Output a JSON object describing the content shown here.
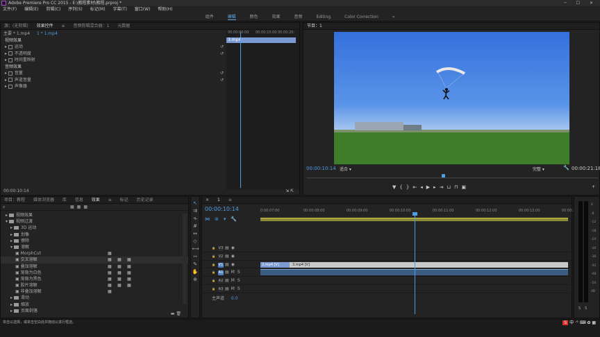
{
  "window": {
    "title": "Adobe Premiere Pro CC 2015 - E:\\教程素材\\教程.prproj *",
    "controls": "─ ☐ ✕"
  },
  "menu": [
    "文件(F)",
    "编辑(E)",
    "剪辑(C)",
    "序列(S)",
    "标记(M)",
    "字幕(T)",
    "窗口(W)",
    "帮助(H)"
  ],
  "workspaces": {
    "items": [
      "组件",
      "编辑",
      "颜色",
      "效果",
      "音频",
      "Editing",
      "Color Correction"
    ],
    "active_index": 1,
    "more": "»"
  },
  "effect_controls": {
    "tabs": [
      "源：(无剪辑)",
      "效果控件",
      "≡",
      "音频剪辑混合器：1",
      "元数据"
    ],
    "active_index": 1,
    "master_label": "主要 * 1.mp4",
    "clip_label": "1 * 1.mp4",
    "video_section": "视频效果",
    "video_effects": [
      "运动",
      "不透明度",
      "时间重映射"
    ],
    "audio_section": "音频效果",
    "audio_effects": [
      "音量",
      "声道音量",
      "声像器"
    ],
    "timecodes": [
      "00:00:00:00",
      "00:00:15:00",
      "00:00:20:"
    ],
    "clip_name": "3.mp4",
    "timecode": "00:00:10:14"
  },
  "program": {
    "tab": "节目：1",
    "timecode": "00:00:10:14",
    "fit": "适合",
    "quality": "完整",
    "duration": "00:00:21:18",
    "playhead_fraction": 0.47,
    "sky_color": "#3f7fe0",
    "grass_color": "#3f7a2b"
  },
  "effects": {
    "tabs": [
      "项目：教程",
      "媒体浏览器",
      "库",
      "信息",
      "效果",
      "≡",
      "标记",
      "历史记录"
    ],
    "active_index": 4,
    "items": [
      {
        "label": "视频效果",
        "indent": 1,
        "open": false,
        "icons": 0
      },
      {
        "label": "视频过渡",
        "indent": 1,
        "open": true,
        "icons": 0
      },
      {
        "label": "3D 运动",
        "indent": 2,
        "open": false,
        "icons": 0
      },
      {
        "label": "划像",
        "indent": 2,
        "open": false,
        "icons": 0
      },
      {
        "label": "擦除",
        "indent": 2,
        "open": false,
        "icons": 0
      },
      {
        "label": "溶解",
        "indent": 2,
        "open": true,
        "icons": 0
      },
      {
        "label": "MorphCut",
        "indent": 3,
        "open": null,
        "icons": 1
      },
      {
        "label": "交叉溶解",
        "indent": 3,
        "open": null,
        "icons": 3,
        "selected": true
      },
      {
        "label": "叠加溶解",
        "indent": 3,
        "open": null,
        "icons": 3
      },
      {
        "label": "渐隐为白色",
        "indent": 3,
        "open": null,
        "icons": 3
      },
      {
        "label": "渐隐为黑色",
        "indent": 3,
        "open": null,
        "icons": 3
      },
      {
        "label": "胶片溶解",
        "indent": 3,
        "open": null,
        "icons": 3
      },
      {
        "label": "非叠加溶解",
        "indent": 3,
        "open": null,
        "icons": 1
      },
      {
        "label": "滑动",
        "indent": 2,
        "open": false,
        "icons": 0
      },
      {
        "label": "缩放",
        "indent": 2,
        "open": false,
        "icons": 0
      },
      {
        "label": "页面剥落",
        "indent": 2,
        "open": false,
        "icons": 0
      }
    ]
  },
  "timeline": {
    "tab": "1",
    "timecode": "00:00:10:14",
    "ruler": [
      "0:00:07:00",
      "00:00:08:00",
      "00:00:09:00",
      "00:00:10:00",
      "00:00:11:00",
      "00:00:12:00",
      "00:00:13:00",
      "00:00:14:"
    ],
    "tracks": [
      {
        "id": "V3",
        "type": "video"
      },
      {
        "id": "V2",
        "type": "video"
      },
      {
        "id": "V1",
        "type": "video",
        "active": true
      },
      {
        "id": "A1",
        "type": "audio",
        "active": true
      },
      {
        "id": "A2",
        "type": "audio"
      },
      {
        "id": "A3",
        "type": "audio"
      }
    ],
    "master": {
      "label": "主声道",
      "value": "0.0"
    },
    "clips": [
      {
        "track": "V1",
        "label": "2.mp4 [V]"
      },
      {
        "track": "V1",
        "label": "3.mp4 [V]"
      }
    ],
    "audio_labels": [
      "M",
      "S"
    ]
  },
  "meter": {
    "labels": [
      "S",
      "S"
    ],
    "scale": [
      "0",
      "-6",
      "-12",
      "-18",
      "-24",
      "-30",
      "-36",
      "-42",
      "-48",
      "-54",
      "dB"
    ]
  },
  "status": {
    "text": "单击以选择，或单击空白处并拖动以进行框选。"
  },
  "colors": {
    "accent": "#4f9ee3",
    "clip": "#7b9ad4",
    "playhead": "#4f9ee3"
  }
}
